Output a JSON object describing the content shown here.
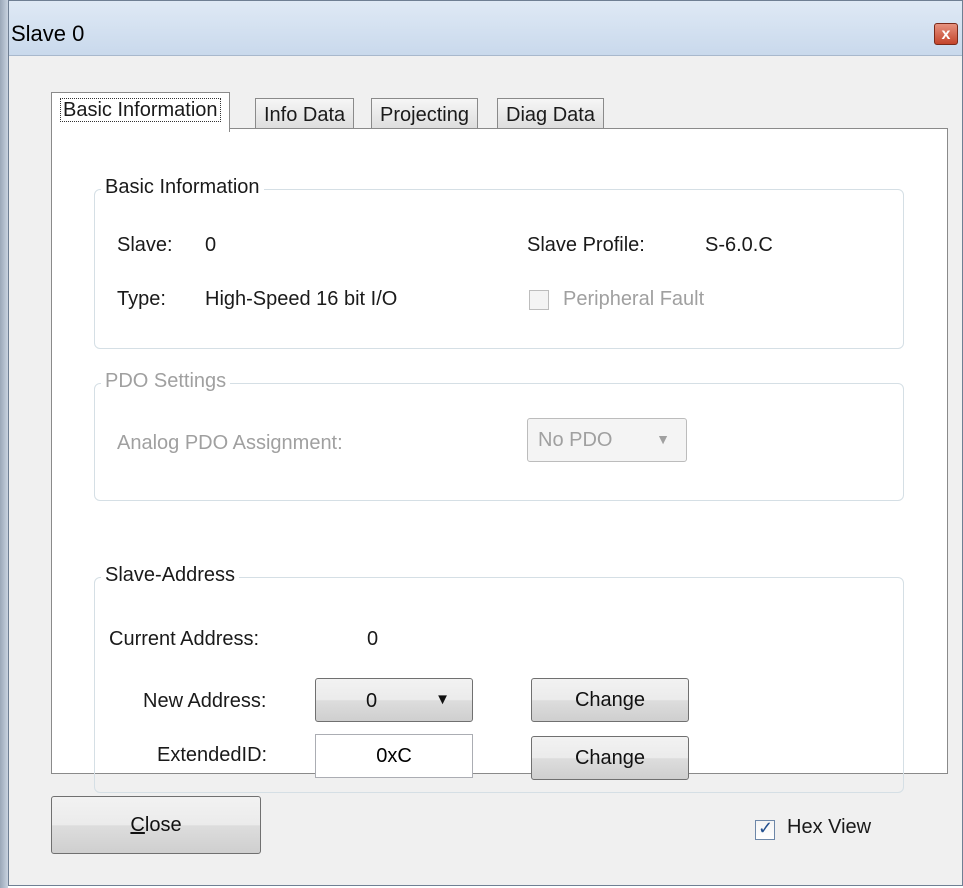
{
  "window": {
    "title": "Slave 0",
    "close_glyph": "x"
  },
  "tabs": [
    {
      "label": "Basic Information",
      "active": true
    },
    {
      "label": "Info Data",
      "active": false
    },
    {
      "label": "Projecting",
      "active": false
    },
    {
      "label": "Diag Data",
      "active": false
    }
  ],
  "basic_info": {
    "group_title": "Basic Information",
    "slave_label": "Slave:",
    "slave_value": "0",
    "profile_label": "Slave Profile:",
    "profile_value": "S-6.0.C",
    "type_label": "Type:",
    "type_value": "High-Speed 16 bit I/O",
    "peripheral_fault_label": "Peripheral Fault",
    "peripheral_fault_checked": false
  },
  "pdo": {
    "group_title": "PDO Settings",
    "assignment_label": "Analog PDO Assignment:",
    "assignment_value": "No PDO"
  },
  "slave_address": {
    "group_title": "Slave-Address",
    "current_label": "Current Address:",
    "current_value": "0",
    "new_label": "New Address:",
    "new_value": "0",
    "extended_label": "ExtendedID:",
    "extended_value": "0xC",
    "change_label": "Change"
  },
  "footer": {
    "close_label_initial": "C",
    "close_label_rest": "lose",
    "hex_view_label": "Hex View",
    "hex_view_checked": true
  }
}
